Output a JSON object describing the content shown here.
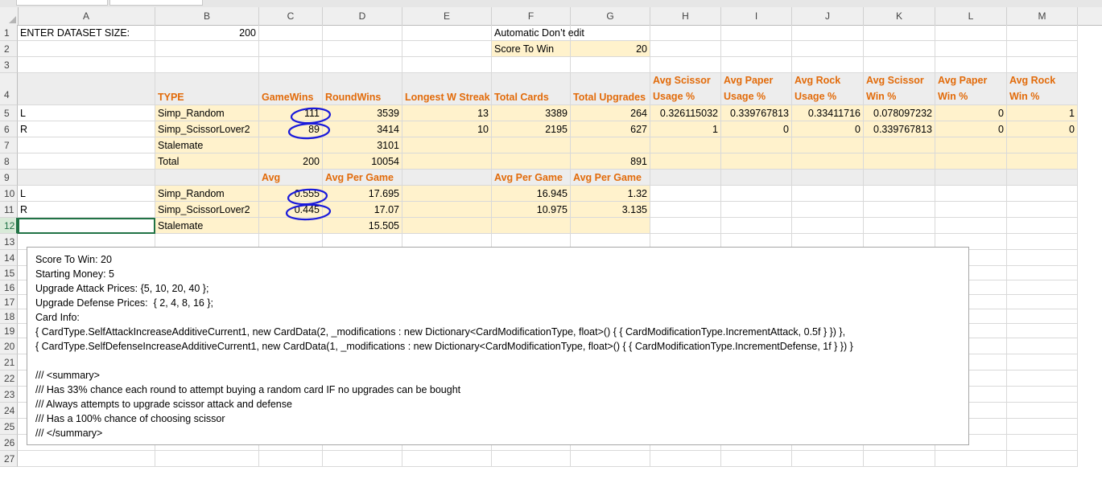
{
  "columns": [
    "A",
    "B",
    "C",
    "D",
    "E",
    "F",
    "G",
    "H",
    "I",
    "J",
    "K",
    "L",
    "M"
  ],
  "rows": [
    "1",
    "2",
    "3",
    "4",
    "5",
    "6",
    "7",
    "8",
    "9",
    "10",
    "11",
    "12",
    "13",
    "14",
    "15",
    "16",
    "17",
    "18",
    "19",
    "20",
    "21",
    "22",
    "23",
    "24",
    "25",
    "26",
    "27"
  ],
  "cells": {
    "A1": "ENTER DATASET SIZE:",
    "B1": "200",
    "F1": "Automatic Don’t edit",
    "F2": "Score To Win",
    "G2": "20",
    "B4": "TYPE",
    "C4": "GameWins",
    "D4": "RoundWins",
    "E4": "Longest W Streak",
    "F4": "Total Cards",
    "G4": "Total Upgrades",
    "H4": "Avg Scissor Usage %",
    "I4": "Avg Paper Usage %",
    "J4": "Avg Rock Usage %",
    "K4": "Avg Scissor Win %",
    "L4": "Avg Paper Win %",
    "M4": "Avg Rock Win %",
    "A5": "L",
    "B5": "Simp_Random",
    "C5": "111",
    "D5": "3539",
    "E5": "13",
    "F5": "3389",
    "G5": "264",
    "H5": "0.326115032",
    "I5": "0.339767813",
    "J5": "0.33411716",
    "K5": "0.078097232",
    "L5": "0",
    "M5": "1",
    "A6": "R",
    "B6": "Simp_ScissorLover2",
    "C6": "89",
    "D6": "3414",
    "E6": "10",
    "F6": "2195",
    "G6": "627",
    "H6": "1",
    "I6": "0",
    "J6": "0",
    "K6": "0.339767813",
    "L6": "0",
    "M6": "0",
    "B7": "Stalemate",
    "D7": "3101",
    "B8": "Total",
    "C8": "200",
    "D8": "10054",
    "G8": "891",
    "C9": "Avg",
    "D9": "Avg Per Game",
    "F9": "Avg Per Game",
    "G9": "Avg Per Game",
    "A10": "L",
    "B10": "Simp_Random",
    "C10": "0.555",
    "D10": "17.695",
    "F10": "16.945",
    "G10": "1.32",
    "A11": "R",
    "B11": "Simp_ScissorLover2",
    "C11": "0.445",
    "D11": "17.07",
    "F11": "10.975",
    "G11": "3.135",
    "B12": "Stalemate",
    "D12": "15.505"
  },
  "textbox": {
    "lines": [
      "Score To Win: 20",
      "Starting Money: 5",
      "Upgrade Attack Prices: {5, 10, 20, 40 };",
      "Upgrade Defense Prices:  { 2, 4, 8, 16 };",
      "Card Info:",
      "{ CardType.SelfAttackIncreaseAdditiveCurrent1, new CardData(2, _modifications : new Dictionary<CardModificationType, float>() { { CardModificationType.IncrementAttack, 0.5f } }) },",
      "{ CardType.SelfDefenseIncreaseAdditiveCurrent1, new CardData(1, _modifications : new Dictionary<CardModificationType, float>() { { CardModificationType.IncrementDefense, 1f } }) }",
      "",
      "/// <summary>",
      "/// Has 33% chance each round to attempt buying a random card IF no upgrades can be bought",
      "/// Always attempts to upgrade scissor attack and defense",
      "/// Has a 100% chance of choosing scissor",
      "/// </summary>"
    ]
  },
  "colors": {
    "highlight_fill": "#fff2cc",
    "header_fill": "#ededed",
    "orange_header_text": "#e26b0a",
    "selection_green": "#217346",
    "annotation_ink": "#1a1adb"
  }
}
